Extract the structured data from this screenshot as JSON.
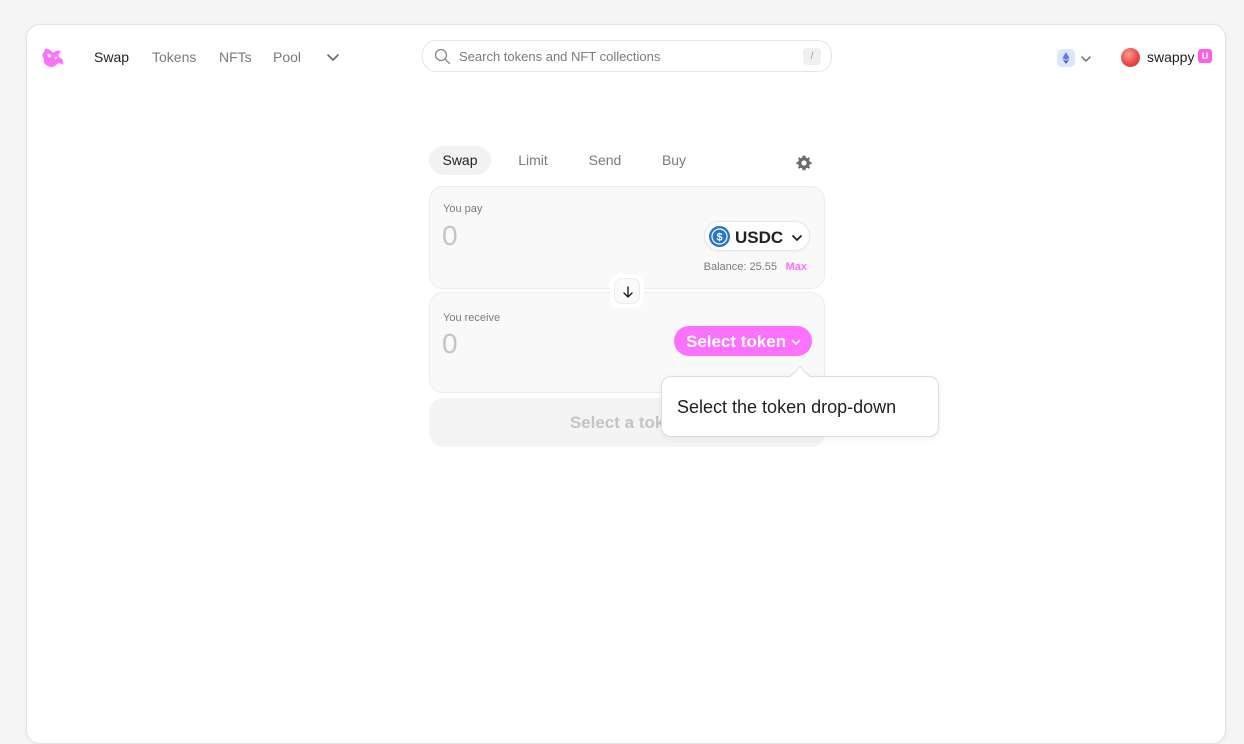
{
  "nav": {
    "items": [
      {
        "label": "Swap",
        "active": true
      },
      {
        "label": "Tokens",
        "active": false
      },
      {
        "label": "NFTs",
        "active": false
      },
      {
        "label": "Pool",
        "active": false
      }
    ],
    "more_icon": "chevron-down-icon",
    "logo_icon": "unicorn-logo-icon"
  },
  "search": {
    "placeholder": "Search tokens and NFT collections",
    "value": "",
    "shortcut": "/"
  },
  "network": {
    "icon": "ethereum-icon",
    "chevron": "chevron-down-icon"
  },
  "account": {
    "name": "swappy",
    "badge": "U"
  },
  "widget": {
    "tabs": [
      {
        "label": "Swap",
        "active": true
      },
      {
        "label": "Limit",
        "active": false
      },
      {
        "label": "Send",
        "active": false
      },
      {
        "label": "Buy",
        "active": false
      }
    ],
    "settings_icon": "gear-icon",
    "pay": {
      "label": "You pay",
      "amount": "0",
      "token": "USDC",
      "balance": "Balance: 25.55",
      "max_label": "Max"
    },
    "switch_icon": "arrow-down-icon",
    "receive": {
      "label": "You receive",
      "amount": "0",
      "select_label": "Select token"
    },
    "main_button": "Select a token"
  },
  "tooltip": {
    "text": "Select the token drop-down"
  },
  "colors": {
    "accent": "#fc72ff",
    "usdc": "#2775ca",
    "muted_text": "#7b7b7b",
    "disabled_text": "#c4c4c4"
  }
}
